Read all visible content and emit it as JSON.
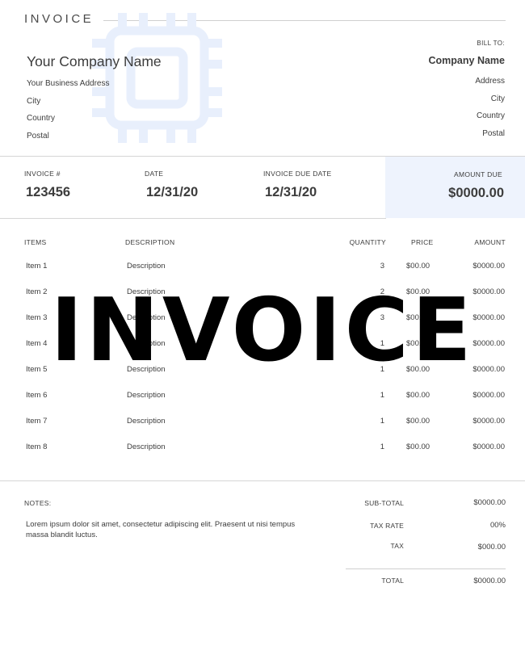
{
  "header": {
    "title": "INVOICE"
  },
  "from": {
    "company": "Your Company Name",
    "address": "Your Business Address",
    "city": "City",
    "country": "Country",
    "postal": "Postal"
  },
  "bill_to": {
    "label": "BILL TO:",
    "company": "Company Name",
    "address": "Address",
    "city": "City",
    "country": "Country",
    "postal": "Postal"
  },
  "info": {
    "invoice_no_label": "INVOICE #",
    "invoice_no": "123456",
    "date_label": "DATE",
    "date": "12/31/20",
    "due_label": "INVOICE DUE DATE",
    "due": "12/31/20",
    "amount_due_label": "AMOUNT DUE",
    "amount_due": "$0000.00"
  },
  "table": {
    "headers": {
      "items": "ITEMS",
      "description": "DESCRIPTION",
      "quantity": "QUANTITY",
      "price": "PRICE",
      "amount": "AMOUNT"
    },
    "rows": [
      {
        "item": "Item 1",
        "description": "Description",
        "quantity": "3",
        "price": "$00.00",
        "amount": "$0000.00"
      },
      {
        "item": "Item 2",
        "description": "Description",
        "quantity": "2",
        "price": "$00.00",
        "amount": "$0000.00"
      },
      {
        "item": "Item 3",
        "description": "Description",
        "quantity": "3",
        "price": "$00.00",
        "amount": "$0000.00"
      },
      {
        "item": "Item 4",
        "description": "Description",
        "quantity": "1",
        "price": "$00.00",
        "amount": "$0000.00"
      },
      {
        "item": "Item 5",
        "description": "Description",
        "quantity": "1",
        "price": "$00.00",
        "amount": "$0000.00"
      },
      {
        "item": "Item 6",
        "description": "Description",
        "quantity": "1",
        "price": "$00.00",
        "amount": "$0000.00"
      },
      {
        "item": "Item 7",
        "description": "Description",
        "quantity": "1",
        "price": "$00.00",
        "amount": "$0000.00"
      },
      {
        "item": "Item 8",
        "description": "Description",
        "quantity": "1",
        "price": "$00.00",
        "amount": "$0000.00"
      }
    ]
  },
  "notes": {
    "label": "NOTES:",
    "text": "Lorem ipsum dolor sit amet, consectetur adipiscing elit. Praesent ut nisi tempus massa blandit luctus."
  },
  "summary": {
    "subtotal_label": "SUB-TOTAL",
    "subtotal": "$0000.00",
    "tax_rate_label": "TAX RATE",
    "tax_rate": "00%",
    "tax_label": "TAX",
    "tax": "$000.00",
    "total_label": "TOTAL",
    "total": "$0000.00"
  },
  "overlay": {
    "title": "INVOICE"
  },
  "colors": {
    "accent_band": "#eef3fd",
    "logo_tint": "#e8effc",
    "text": "#3c3c3c",
    "overlay": "#000000"
  },
  "icons": {
    "logo": "chip-icon"
  }
}
